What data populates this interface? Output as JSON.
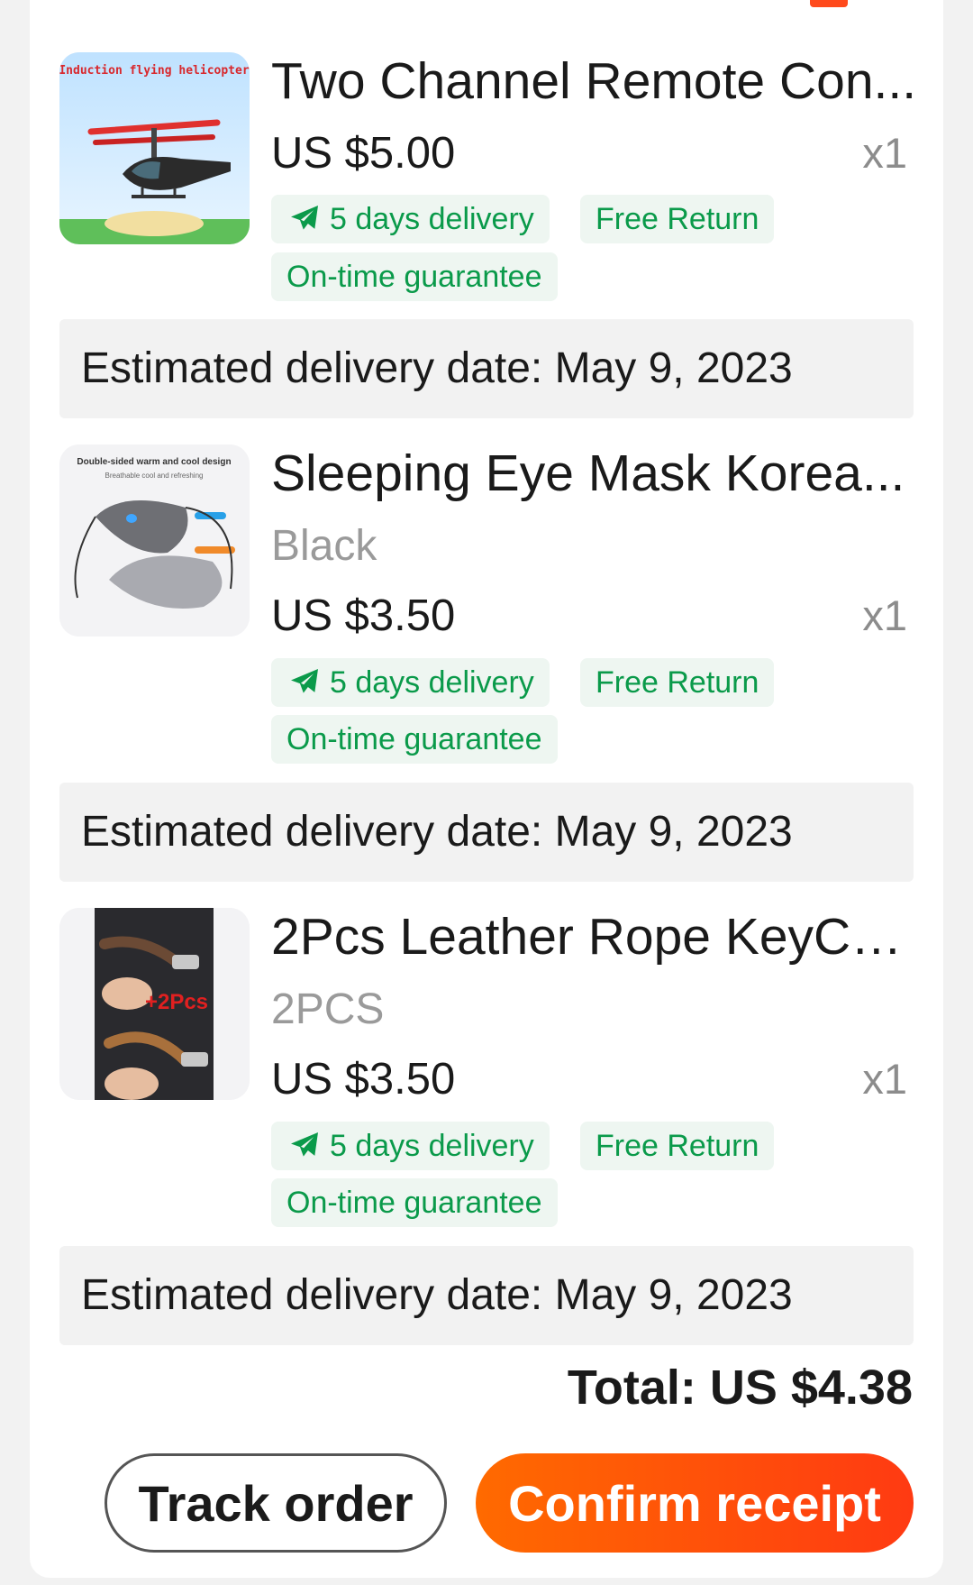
{
  "items": [
    {
      "title": "Two Channel Remote Con...",
      "variant": "",
      "price": "US $5.00",
      "qty": "x1",
      "delivery": "5 days delivery",
      "free_return": "Free Return",
      "guarantee": "On-time guarantee",
      "eta": "Estimated delivery date: May 9, 2023",
      "thumb_text": "Induction flying helicopter"
    },
    {
      "title": "Sleeping Eye Mask Korea...",
      "variant": "Black",
      "price": "US $3.50",
      "qty": "x1",
      "delivery": "5 days delivery",
      "free_return": "Free Return",
      "guarantee": "On-time guarantee",
      "eta": "Estimated delivery date: May 9, 2023",
      "thumb_text": "Double-sided warm and cool design",
      "thumb_subtext": "Breathable cool and refreshing"
    },
    {
      "title": "2Pcs Leather Rope KeyCh...",
      "variant": "2PCS",
      "price": "US $3.50",
      "qty": "x1",
      "delivery": "5 days delivery",
      "free_return": "Free Return",
      "guarantee": "On-time guarantee",
      "eta": "Estimated delivery date: May 9, 2023",
      "thumb_text": "+2Pcs"
    }
  ],
  "summary": {
    "total": "Total: US $4.38"
  },
  "actions": {
    "track": "Track order",
    "confirm": "Confirm receipt"
  },
  "colors": {
    "accent": "#ff4a1c",
    "green": "#0a9a4a",
    "chip_bg": "#eef6f1"
  },
  "icons": {
    "delivery": "airplane-icon"
  }
}
